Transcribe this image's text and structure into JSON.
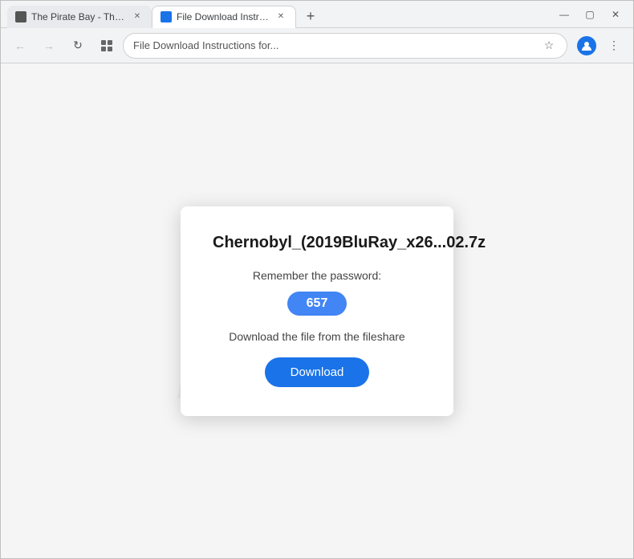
{
  "browser": {
    "tabs": [
      {
        "id": "tab-pirate-bay",
        "title": "The Pirate Bay - The galaxy's m...",
        "favicon": "pirate",
        "active": false
      },
      {
        "id": "tab-file-download",
        "title": "File Download Instructions for...",
        "favicon": "doc",
        "active": true
      }
    ],
    "new_tab_label": "+",
    "window_controls": {
      "minimize": "—",
      "maximize": "▢",
      "close": "✕"
    },
    "nav": {
      "back": "←",
      "forward": "→",
      "refresh": "↺",
      "extensions": "⊞",
      "address": "File Download Instructions for...",
      "bookmark": "☆",
      "profile": "person",
      "menu": "⋮"
    }
  },
  "watermark": {
    "text": "FISH.LTD"
  },
  "dialog": {
    "title": "Chernobyl_(2019BluRay_x26...02.7z",
    "remember_label": "Remember the password:",
    "password": "657",
    "instruction": "Download the file from the fileshare",
    "download_label": "Download"
  }
}
